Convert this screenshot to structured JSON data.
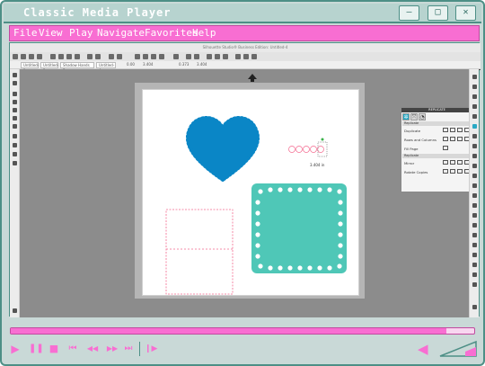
{
  "player": {
    "title": "Classic Media Player",
    "window_buttons": {
      "minimize": "—",
      "maximize": "□",
      "close": "✕"
    },
    "menu": [
      "File",
      "View",
      "Play",
      "Navigate",
      "Favorites",
      "Help"
    ],
    "progress": 0.94,
    "controls": {
      "play": "▶",
      "pause": "❚❚",
      "stop": "■",
      "prev": "⏮",
      "rewind": "◀◀",
      "forward": "▶▶",
      "next": "⏭",
      "frame": "❙▶"
    },
    "colors": {
      "accent": "#f86ed2",
      "frame": "#4d8f86",
      "background": "#c9d9d7"
    }
  },
  "app": {
    "window_title": "Silhouette Studio® Business Edition: Untitled-4",
    "tabs": [
      {
        "label": "DESIGN",
        "active": true
      },
      {
        "label": "STORE",
        "active": false
      },
      {
        "label": "LIBRARY",
        "active": false
      },
      {
        "label": "SEND",
        "active": false
      }
    ],
    "doc_tabs": [
      "Untitled-1",
      "Untitled-2",
      "Shadow Hands Fu...",
      "Untitled-4"
    ],
    "toolbar_values": {
      "stroke": "0.00",
      "width": "3.404",
      "height": "0.373",
      "dim": "3.404"
    },
    "selection_label": "3.404 in",
    "panel": {
      "title": "REPLICATE",
      "sections": [
        {
          "label": "Replicate",
          "rows": [
            "Duplicate",
            "Rows and Columns",
            "Fill Page"
          ]
        },
        {
          "label": "Replicate",
          "rows": [
            "Mirror",
            "Rotate Copies"
          ]
        }
      ]
    },
    "shapes": [
      {
        "name": "heart",
        "color": "#0a86c6"
      },
      {
        "name": "scalloped-square",
        "color": "#4fc7b7"
      },
      {
        "name": "pink-outline-rectangle",
        "color": "#f46a8f"
      }
    ]
  }
}
